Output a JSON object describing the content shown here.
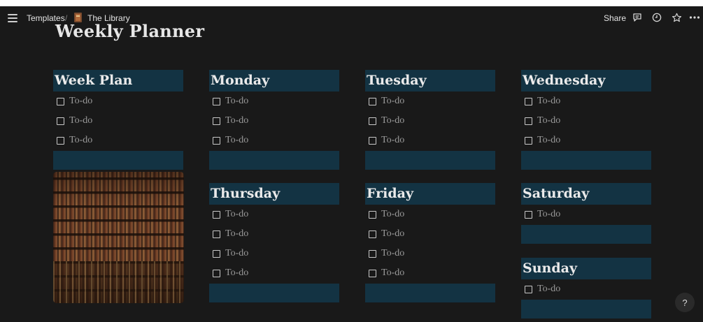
{
  "topbar": {
    "breadcrumb_templates": "Templates",
    "breadcrumb_separator": "/",
    "breadcrumb_page": "The Library",
    "share_label": "Share",
    "icons": [
      "menu-icon",
      "book-icon",
      "comment-icon",
      "clock-icon",
      "star-icon",
      "more-icon"
    ]
  },
  "page": {
    "title": "Weekly Planner"
  },
  "sections": {
    "week_plan": {
      "heading": "Week Plan",
      "todos": [
        "To-do",
        "To-do",
        "To-do"
      ]
    },
    "monday": {
      "heading": "Monday",
      "todos": [
        "To-do",
        "To-do",
        "To-do"
      ]
    },
    "tuesday": {
      "heading": "Tuesday",
      "todos": [
        "To-do",
        "To-do",
        "To-do"
      ]
    },
    "wednesday": {
      "heading": "Wednesday",
      "todos": [
        "To-do",
        "To-do",
        "To-do"
      ]
    },
    "thursday": {
      "heading": "Thursday",
      "todos": [
        "To-do",
        "To-do",
        "To-do",
        "To-do"
      ]
    },
    "friday": {
      "heading": "Friday",
      "todos": [
        "To-do",
        "To-do",
        "To-do",
        "To-do"
      ]
    },
    "saturday": {
      "heading": "Saturday",
      "todos": [
        "To-do"
      ]
    },
    "sunday": {
      "heading": "Sunday",
      "todos": [
        "To-do"
      ]
    }
  },
  "help_label": "?",
  "colors": {
    "background": "#191919",
    "heading_block": "#133343",
    "text": "#eaeaea",
    "muted_text": "#9a9a9a"
  }
}
